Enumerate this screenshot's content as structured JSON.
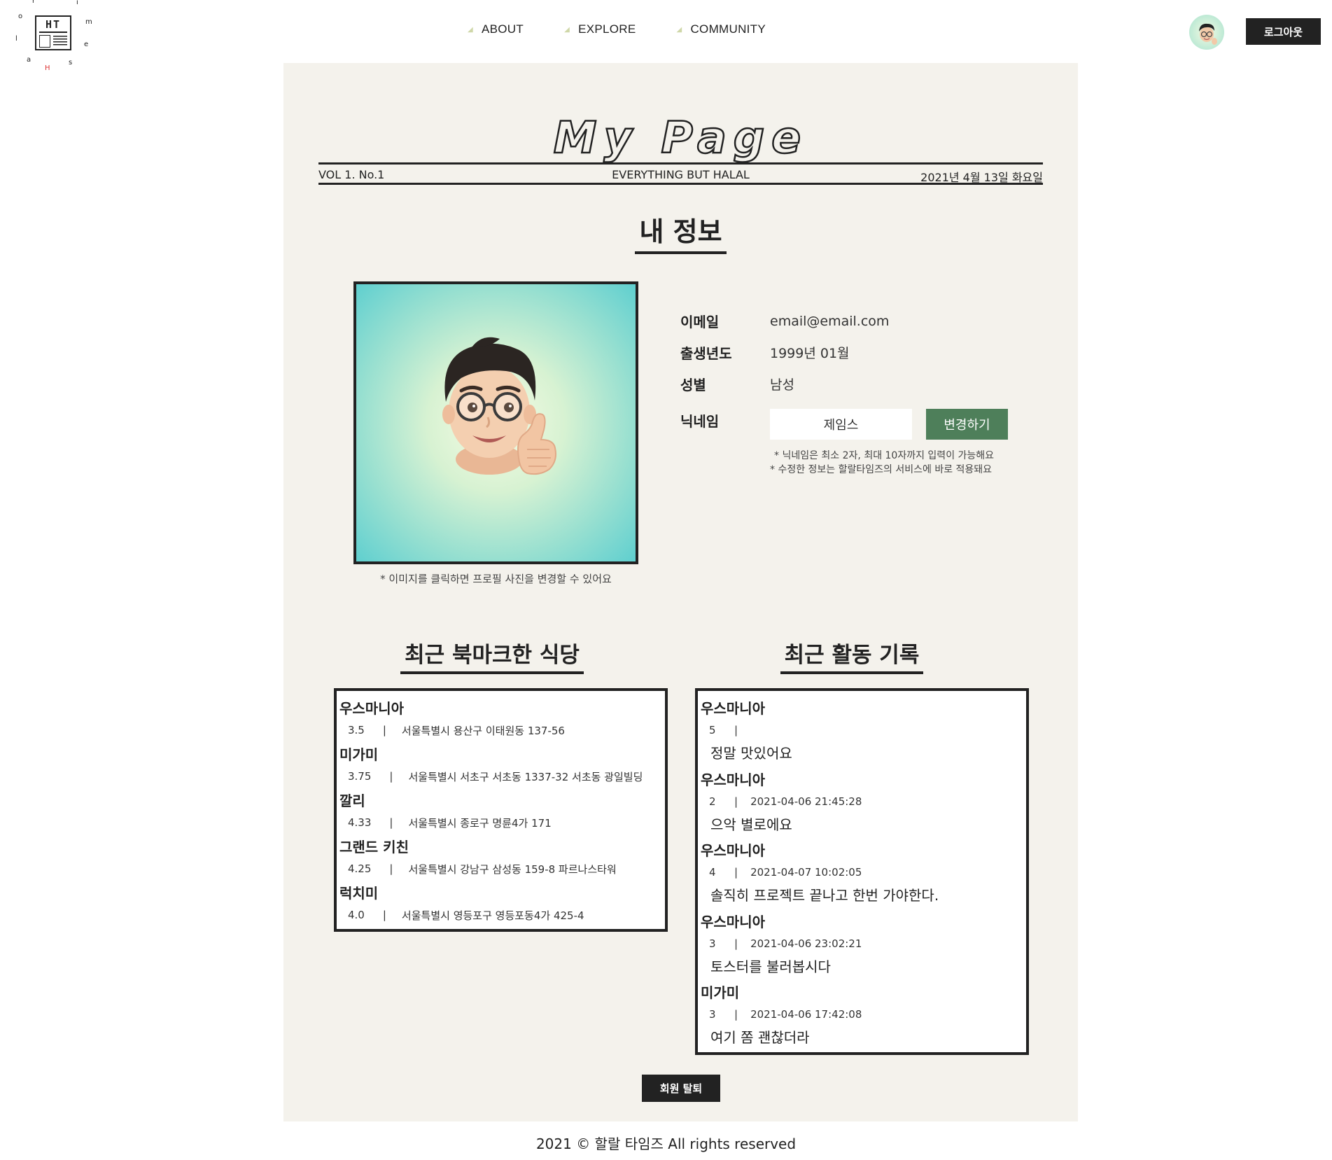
{
  "header": {
    "logo_text": "HT",
    "nav": [
      {
        "label": "ABOUT"
      },
      {
        "label": "EXPLORE"
      },
      {
        "label": "COMMUNITY"
      }
    ],
    "logout_label": "로그아웃"
  },
  "masthead": {
    "title": "My Page",
    "vol": "VOL 1. No.1",
    "slogan": "EVERYTHING BUT HALAL",
    "date": "2021년 4월 13일 화요일"
  },
  "profile": {
    "section_title": "내 정보",
    "picture_caption": "* 이미지를 클릭하면 프로필 사진을 변경할 수 있어요",
    "email_label": "이메일",
    "email": "email@email.com",
    "birth_label": "출생년도",
    "birth": "1999년 01월",
    "gender_label": "성별",
    "gender": "남성",
    "nickname_label": "닉네임",
    "nickname": "제임스",
    "change_label": "변경하기",
    "note1": "* 닉네임은 최소 2자, 최대 10자까지 입력이 가능해요",
    "note2": "* 수정한 정보는 할랄타임즈의 서비스에 바로 적용돼요"
  },
  "bookmarks": {
    "section_title": "최근 북마크한 식당",
    "items": [
      {
        "name": "우스마니아",
        "rating": "3.5",
        "address": "서울특별시 용산구 이태원동 137-56"
      },
      {
        "name": "미가미",
        "rating": "3.75",
        "address": "서울특별시 서초구 서초동 1337-32 서초동 광일빌딩"
      },
      {
        "name": "깔리",
        "rating": "4.33",
        "address": "서울특별시 종로구 명륜4가 171"
      },
      {
        "name": "그랜드 키친",
        "rating": "4.25",
        "address": "서울특별시 강남구 삼성동 159-8 파르나스타워"
      },
      {
        "name": "럭치미",
        "rating": "4.0",
        "address": "서울특별시 영등포구 영등포동4가 425-4"
      }
    ]
  },
  "activity": {
    "section_title": "최근 활동 기록",
    "items": [
      {
        "name": "우스마니아",
        "rating": "5",
        "datetime": "",
        "comment": "정말 맛있어요"
      },
      {
        "name": "우스마니아",
        "rating": "2",
        "datetime": "2021-04-06 21:45:28",
        "comment": "으악 별로에요"
      },
      {
        "name": "우스마니아",
        "rating": "4",
        "datetime": "2021-04-07 10:02:05",
        "comment": "솔직히 프로젝트 끝나고 한번 가야한다."
      },
      {
        "name": "우스마니아",
        "rating": "3",
        "datetime": "2021-04-06 23:02:21",
        "comment": "토스터를 불러봅시다"
      },
      {
        "name": "미가미",
        "rating": "3",
        "datetime": "2021-04-06 17:42:08",
        "comment": "여기 쫌 괜찮더라"
      }
    ]
  },
  "withdraw_label": "회원 탈퇴",
  "footer": "2021 © 할랄 타임즈 All rights reserved",
  "colors": {
    "paper": "#f4f2ec",
    "accent_green": "#4e7f5a",
    "dark": "#222222"
  }
}
